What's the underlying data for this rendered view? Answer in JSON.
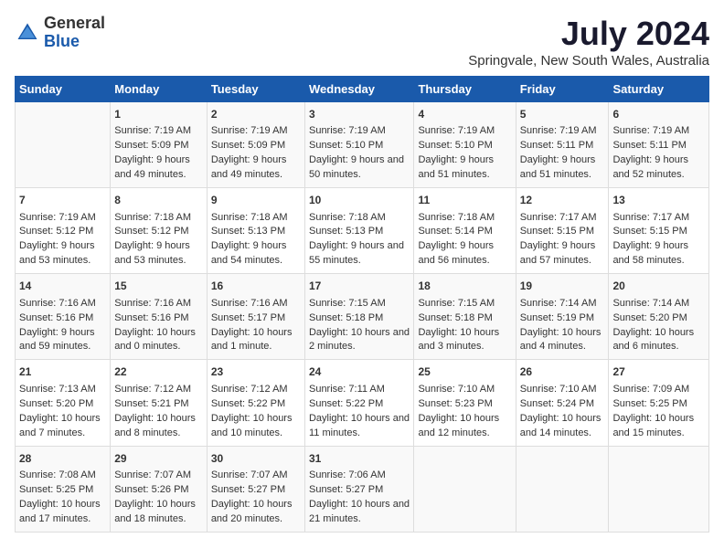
{
  "logo": {
    "general": "General",
    "blue": "Blue"
  },
  "title": "July 2024",
  "subtitle": "Springvale, New South Wales, Australia",
  "days_header": [
    "Sunday",
    "Monday",
    "Tuesday",
    "Wednesday",
    "Thursday",
    "Friday",
    "Saturday"
  ],
  "weeks": [
    [
      {
        "num": "",
        "sunrise": "",
        "sunset": "",
        "daylight": ""
      },
      {
        "num": "1",
        "sunrise": "Sunrise: 7:19 AM",
        "sunset": "Sunset: 5:09 PM",
        "daylight": "Daylight: 9 hours and 49 minutes."
      },
      {
        "num": "2",
        "sunrise": "Sunrise: 7:19 AM",
        "sunset": "Sunset: 5:09 PM",
        "daylight": "Daylight: 9 hours and 49 minutes."
      },
      {
        "num": "3",
        "sunrise": "Sunrise: 7:19 AM",
        "sunset": "Sunset: 5:10 PM",
        "daylight": "Daylight: 9 hours and 50 minutes."
      },
      {
        "num": "4",
        "sunrise": "Sunrise: 7:19 AM",
        "sunset": "Sunset: 5:10 PM",
        "daylight": "Daylight: 9 hours and 51 minutes."
      },
      {
        "num": "5",
        "sunrise": "Sunrise: 7:19 AM",
        "sunset": "Sunset: 5:11 PM",
        "daylight": "Daylight: 9 hours and 51 minutes."
      },
      {
        "num": "6",
        "sunrise": "Sunrise: 7:19 AM",
        "sunset": "Sunset: 5:11 PM",
        "daylight": "Daylight: 9 hours and 52 minutes."
      }
    ],
    [
      {
        "num": "7",
        "sunrise": "Sunrise: 7:19 AM",
        "sunset": "Sunset: 5:12 PM",
        "daylight": "Daylight: 9 hours and 53 minutes."
      },
      {
        "num": "8",
        "sunrise": "Sunrise: 7:18 AM",
        "sunset": "Sunset: 5:12 PM",
        "daylight": "Daylight: 9 hours and 53 minutes."
      },
      {
        "num": "9",
        "sunrise": "Sunrise: 7:18 AM",
        "sunset": "Sunset: 5:13 PM",
        "daylight": "Daylight: 9 hours and 54 minutes."
      },
      {
        "num": "10",
        "sunrise": "Sunrise: 7:18 AM",
        "sunset": "Sunset: 5:13 PM",
        "daylight": "Daylight: 9 hours and 55 minutes."
      },
      {
        "num": "11",
        "sunrise": "Sunrise: 7:18 AM",
        "sunset": "Sunset: 5:14 PM",
        "daylight": "Daylight: 9 hours and 56 minutes."
      },
      {
        "num": "12",
        "sunrise": "Sunrise: 7:17 AM",
        "sunset": "Sunset: 5:15 PM",
        "daylight": "Daylight: 9 hours and 57 minutes."
      },
      {
        "num": "13",
        "sunrise": "Sunrise: 7:17 AM",
        "sunset": "Sunset: 5:15 PM",
        "daylight": "Daylight: 9 hours and 58 minutes."
      }
    ],
    [
      {
        "num": "14",
        "sunrise": "Sunrise: 7:16 AM",
        "sunset": "Sunset: 5:16 PM",
        "daylight": "Daylight: 9 hours and 59 minutes."
      },
      {
        "num": "15",
        "sunrise": "Sunrise: 7:16 AM",
        "sunset": "Sunset: 5:16 PM",
        "daylight": "Daylight: 10 hours and 0 minutes."
      },
      {
        "num": "16",
        "sunrise": "Sunrise: 7:16 AM",
        "sunset": "Sunset: 5:17 PM",
        "daylight": "Daylight: 10 hours and 1 minute."
      },
      {
        "num": "17",
        "sunrise": "Sunrise: 7:15 AM",
        "sunset": "Sunset: 5:18 PM",
        "daylight": "Daylight: 10 hours and 2 minutes."
      },
      {
        "num": "18",
        "sunrise": "Sunrise: 7:15 AM",
        "sunset": "Sunset: 5:18 PM",
        "daylight": "Daylight: 10 hours and 3 minutes."
      },
      {
        "num": "19",
        "sunrise": "Sunrise: 7:14 AM",
        "sunset": "Sunset: 5:19 PM",
        "daylight": "Daylight: 10 hours and 4 minutes."
      },
      {
        "num": "20",
        "sunrise": "Sunrise: 7:14 AM",
        "sunset": "Sunset: 5:20 PM",
        "daylight": "Daylight: 10 hours and 6 minutes."
      }
    ],
    [
      {
        "num": "21",
        "sunrise": "Sunrise: 7:13 AM",
        "sunset": "Sunset: 5:20 PM",
        "daylight": "Daylight: 10 hours and 7 minutes."
      },
      {
        "num": "22",
        "sunrise": "Sunrise: 7:12 AM",
        "sunset": "Sunset: 5:21 PM",
        "daylight": "Daylight: 10 hours and 8 minutes."
      },
      {
        "num": "23",
        "sunrise": "Sunrise: 7:12 AM",
        "sunset": "Sunset: 5:22 PM",
        "daylight": "Daylight: 10 hours and 10 minutes."
      },
      {
        "num": "24",
        "sunrise": "Sunrise: 7:11 AM",
        "sunset": "Sunset: 5:22 PM",
        "daylight": "Daylight: 10 hours and 11 minutes."
      },
      {
        "num": "25",
        "sunrise": "Sunrise: 7:10 AM",
        "sunset": "Sunset: 5:23 PM",
        "daylight": "Daylight: 10 hours and 12 minutes."
      },
      {
        "num": "26",
        "sunrise": "Sunrise: 7:10 AM",
        "sunset": "Sunset: 5:24 PM",
        "daylight": "Daylight: 10 hours and 14 minutes."
      },
      {
        "num": "27",
        "sunrise": "Sunrise: 7:09 AM",
        "sunset": "Sunset: 5:25 PM",
        "daylight": "Daylight: 10 hours and 15 minutes."
      }
    ],
    [
      {
        "num": "28",
        "sunrise": "Sunrise: 7:08 AM",
        "sunset": "Sunset: 5:25 PM",
        "daylight": "Daylight: 10 hours and 17 minutes."
      },
      {
        "num": "29",
        "sunrise": "Sunrise: 7:07 AM",
        "sunset": "Sunset: 5:26 PM",
        "daylight": "Daylight: 10 hours and 18 minutes."
      },
      {
        "num": "30",
        "sunrise": "Sunrise: 7:07 AM",
        "sunset": "Sunset: 5:27 PM",
        "daylight": "Daylight: 10 hours and 20 minutes."
      },
      {
        "num": "31",
        "sunrise": "Sunrise: 7:06 AM",
        "sunset": "Sunset: 5:27 PM",
        "daylight": "Daylight: 10 hours and 21 minutes."
      },
      {
        "num": "",
        "sunrise": "",
        "sunset": "",
        "daylight": ""
      },
      {
        "num": "",
        "sunrise": "",
        "sunset": "",
        "daylight": ""
      },
      {
        "num": "",
        "sunrise": "",
        "sunset": "",
        "daylight": ""
      }
    ]
  ]
}
